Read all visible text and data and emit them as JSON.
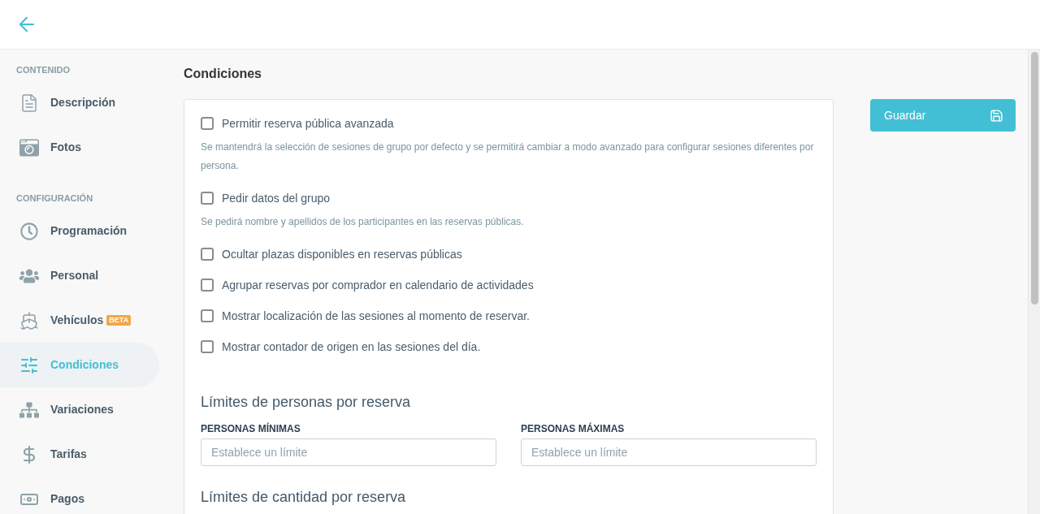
{
  "sidebar": {
    "sections": [
      {
        "title": "CONTENIDO",
        "items": [
          {
            "label": "Descripción",
            "selected": false
          },
          {
            "label": "Fotos",
            "selected": false
          }
        ]
      },
      {
        "title": "CONFIGURACIÓN",
        "items": [
          {
            "label": "Programación",
            "selected": false
          },
          {
            "label": "Personal",
            "selected": false
          },
          {
            "label": "Vehículos",
            "badge": "BETA",
            "selected": false
          },
          {
            "label": "Condiciones",
            "selected": true
          },
          {
            "label": "Variaciones",
            "selected": false
          },
          {
            "label": "Tarifas",
            "selected": false
          },
          {
            "label": "Pagos",
            "selected": false
          }
        ]
      }
    ]
  },
  "page": {
    "title": "Condiciones",
    "options": [
      {
        "label": "Permitir reserva pública avanzada",
        "description": "Se mantendrá la selección de sesiones de grupo por defecto y se permitirá cambiar a modo avanzado para configurar sesiones diferentes por persona.",
        "checked": false
      },
      {
        "label": "Pedir datos del grupo",
        "description": "Se pedirá nombre y apellidos de los participantes en las reservas públicas.",
        "checked": false
      },
      {
        "label": "Ocultar plazas disponibles en reservas públicas",
        "checked": false
      },
      {
        "label": "Agrupar reservas por comprador en calendario de actividades",
        "checked": false
      },
      {
        "label": "Mostrar localización de las sesiones al momento de reservar.",
        "checked": false
      },
      {
        "label": "Mostrar contador de origen en las sesiones del día.",
        "checked": false
      }
    ],
    "limit_groups": [
      {
        "heading": "Límites de personas por reserva",
        "fields": [
          {
            "label": "PERSONAS MÍNIMAS",
            "placeholder": "Establece un límite"
          },
          {
            "label": "PERSONAS MÁXIMAS",
            "placeholder": "Establece un límite"
          }
        ]
      },
      {
        "heading": "Límites de cantidad por reserva"
      }
    ]
  },
  "save_button": {
    "label": "Guardar"
  }
}
